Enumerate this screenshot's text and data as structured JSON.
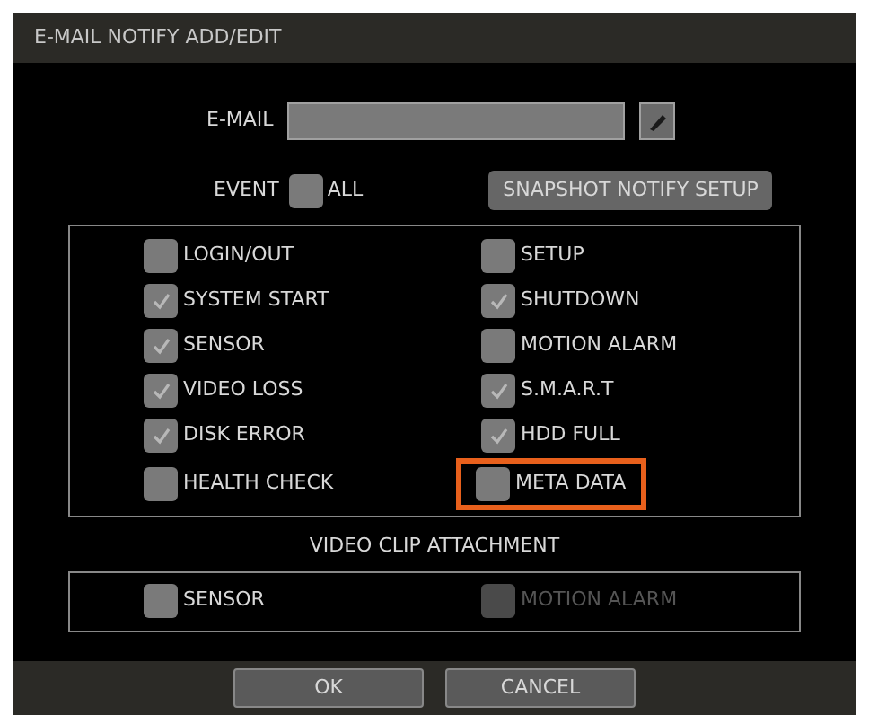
{
  "window": {
    "title": "E-MAIL NOTIFY ADD/EDIT"
  },
  "email": {
    "label": "E-MAIL"
  },
  "event": {
    "label": "EVENT",
    "all": {
      "label": "ALL",
      "checked": false
    },
    "snapshot_button": "SNAPSHOT NOTIFY SETUP"
  },
  "events": [
    {
      "label": "LOGIN/OUT",
      "checked": false,
      "highlighted": false
    },
    {
      "label": "SETUP",
      "checked": false,
      "highlighted": false
    },
    {
      "label": "SYSTEM START",
      "checked": true,
      "highlighted": false
    },
    {
      "label": "SHUTDOWN",
      "checked": true,
      "highlighted": false
    },
    {
      "label": "SENSOR",
      "checked": true,
      "highlighted": false
    },
    {
      "label": "MOTION ALARM",
      "checked": false,
      "highlighted": false
    },
    {
      "label": "VIDEO LOSS",
      "checked": true,
      "highlighted": false
    },
    {
      "label": "S.M.A.R.T",
      "checked": true,
      "highlighted": false
    },
    {
      "label": "DISK ERROR",
      "checked": true,
      "highlighted": false
    },
    {
      "label": "HDD FULL",
      "checked": true,
      "highlighted": false
    },
    {
      "label": "HEALTH CHECK",
      "checked": false,
      "highlighted": false
    },
    {
      "label": "META DATA",
      "checked": false,
      "highlighted": true
    }
  ],
  "clip": {
    "title": "VIDEO CLIP ATTACHMENT",
    "items": [
      {
        "label": "SENSOR",
        "checked": false,
        "disabled": false
      },
      {
        "label": "MOTION ALARM",
        "checked": false,
        "disabled": true
      }
    ]
  },
  "buttons": [
    "OK",
    "CANCEL"
  ]
}
